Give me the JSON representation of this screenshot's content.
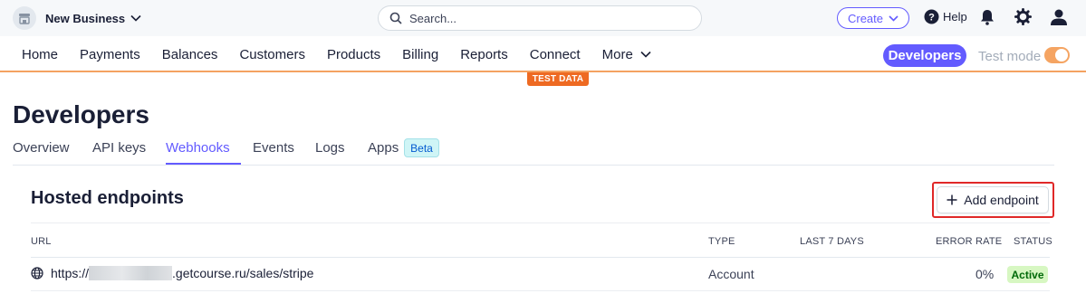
{
  "topbar": {
    "account_name": "New Business",
    "search_placeholder": "Search...",
    "create_label": "Create",
    "help_label": "Help"
  },
  "nav": {
    "items": [
      {
        "label": "Home"
      },
      {
        "label": "Payments"
      },
      {
        "label": "Balances"
      },
      {
        "label": "Customers"
      },
      {
        "label": "Products"
      },
      {
        "label": "Billing"
      },
      {
        "label": "Reports"
      },
      {
        "label": "Connect"
      },
      {
        "label": "More"
      }
    ],
    "developers_label": "Developers",
    "test_mode_label": "Test mode",
    "test_mode_on": true
  },
  "test_data_banner": "TEST DATA",
  "page": {
    "title": "Developers",
    "tabs": [
      {
        "label": "Overview",
        "active": false
      },
      {
        "label": "API keys",
        "active": false
      },
      {
        "label": "Webhooks",
        "active": true
      },
      {
        "label": "Events",
        "active": false
      },
      {
        "label": "Logs",
        "active": false
      },
      {
        "label": "Apps",
        "active": false
      }
    ],
    "beta_badge": "Beta"
  },
  "endpoints": {
    "title": "Hosted endpoints",
    "add_label": "Add endpoint",
    "columns": {
      "url": "URL",
      "type": "TYPE",
      "last7": "LAST 7 DAYS",
      "error_rate": "ERROR RATE",
      "status": "STATUS"
    },
    "rows": [
      {
        "url_prefix": "https://",
        "url_suffix": ".getcourse.ru/sales/stripe",
        "type": "Account",
        "error_rate": "0%",
        "status": "Active"
      }
    ]
  },
  "colors": {
    "accent": "#635bff",
    "test_mode": "#ee6a22",
    "active_badge_bg": "#d7f7c2",
    "highlight": "#e02828"
  }
}
